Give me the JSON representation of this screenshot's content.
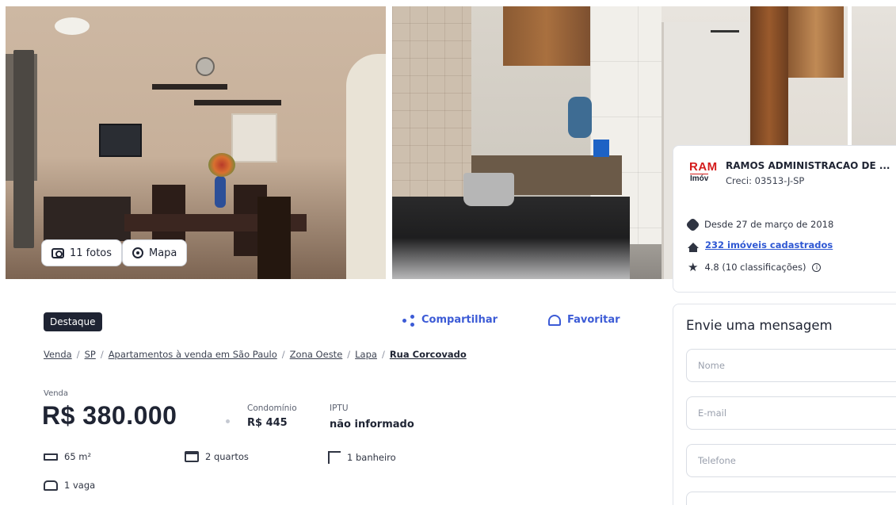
{
  "gallery": {
    "photos_label": "11 fotos",
    "map_label": "Mapa"
  },
  "listing": {
    "badge": "Destaque",
    "share_label": "Compartilhar",
    "favorite_label": "Favoritar",
    "breadcrumb": [
      "Venda",
      "SP",
      "Apartamentos à venda em São Paulo",
      "Zona Oeste",
      "Lapa",
      "Rua Corcovado"
    ],
    "sale_label": "Venda",
    "price": "R$ 380.000",
    "condominio_label": "Condomínio",
    "condominio_value": "R$ 445",
    "iptu_label": "IPTU",
    "iptu_value": "não informado",
    "features": {
      "area": "65 m²",
      "rooms": "2 quartos",
      "bath": "1 banheiro",
      "parking": "1 vaga"
    }
  },
  "agency": {
    "logo_top": "RAM",
    "logo_bottom": "Imóv",
    "name": "RAMOS ADMINISTRACAO DE ...",
    "creci": "Creci: 03513-J-SP",
    "since": "Desde 27 de março de 2018",
    "listings": "232 imóveis cadastrados",
    "rating": "4.8 (10 classificações)"
  },
  "form": {
    "title": "Envie uma mensagem",
    "name_placeholder": "Nome",
    "email_placeholder": "E-mail",
    "phone_placeholder": "Telefone",
    "message_placeholder": ""
  },
  "colors": {
    "accent": "#3c5bd6",
    "link": "#2f58d3",
    "badge_bg": "#1f2433",
    "brand_red": "#d41c1c"
  },
  "icons": [
    "camera-icon",
    "map-pin-icon",
    "share-icon",
    "heart-icon",
    "ruler-icon",
    "bed-icon",
    "shower-icon",
    "car-icon",
    "seal-icon",
    "house-icon",
    "star-icon",
    "info-icon"
  ]
}
